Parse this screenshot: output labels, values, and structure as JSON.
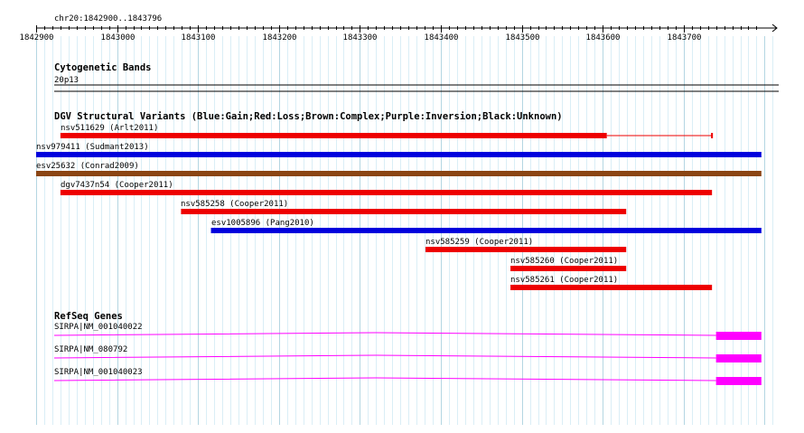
{
  "ruler": {
    "location": "chr20:1842900..1843796",
    "ticks": [
      "1842900",
      "1843000",
      "1843100",
      "1843200",
      "1843300",
      "1843400",
      "1843500",
      "1843600",
      "1843700"
    ],
    "start": 1842900,
    "end": 1843796
  },
  "cytoband": {
    "title": "Cytogenetic Bands",
    "band": "20p13"
  },
  "dgv": {
    "title": "DGV Structural Variants (Blue:Gain;Red:Loss;Brown:Complex;Purple:Inversion;Black:Unknown)",
    "colors": {
      "gain": "#0000dd",
      "loss": "#ee0000",
      "complex": "#8b4513"
    },
    "variants": [
      {
        "label": "nsv511629 (Arlt2011)",
        "type": "loss",
        "start": 1842930,
        "end": 1843605,
        "tail_end": 1843735
      },
      {
        "label": "nsv979411 (Sudmant2013)",
        "type": "gain",
        "start": 1842900,
        "end": 1843796
      },
      {
        "label": "esv25632 (Conrad2009)",
        "type": "complex",
        "start": 1842900,
        "end": 1843796
      },
      {
        "label": "dgv7437n54 (Cooper2011)",
        "type": "loss",
        "start": 1842930,
        "end": 1843735
      },
      {
        "label": "nsv585258 (Cooper2011)",
        "type": "loss",
        "start": 1843079,
        "end": 1843629
      },
      {
        "label": "esv1005896 (Pang2010)",
        "type": "gain",
        "start": 1843116,
        "end": 1843796
      },
      {
        "label": "nsv585259 (Cooper2011)",
        "type": "loss",
        "start": 1843381,
        "end": 1843629
      },
      {
        "label": "nsv585260 (Cooper2011)",
        "type": "loss",
        "start": 1843486,
        "end": 1843629
      },
      {
        "label": "nsv585261 (Cooper2011)",
        "type": "loss",
        "start": 1843486,
        "end": 1843735
      }
    ]
  },
  "refseq": {
    "title": "RefSeq Genes",
    "color": "#ff00ff",
    "genes": [
      {
        "label": "SIRPA|NM_001040022",
        "intron_start": 1842900,
        "exon_start": 1843740,
        "exon_end": 1843796
      },
      {
        "label": "SIRPA|NM_080792",
        "intron_start": 1842900,
        "exon_start": 1843740,
        "exon_end": 1843796
      },
      {
        "label": "SIRPA|NM_001040023",
        "intron_start": 1842900,
        "exon_start": 1843740,
        "exon_end": 1843796
      }
    ]
  }
}
